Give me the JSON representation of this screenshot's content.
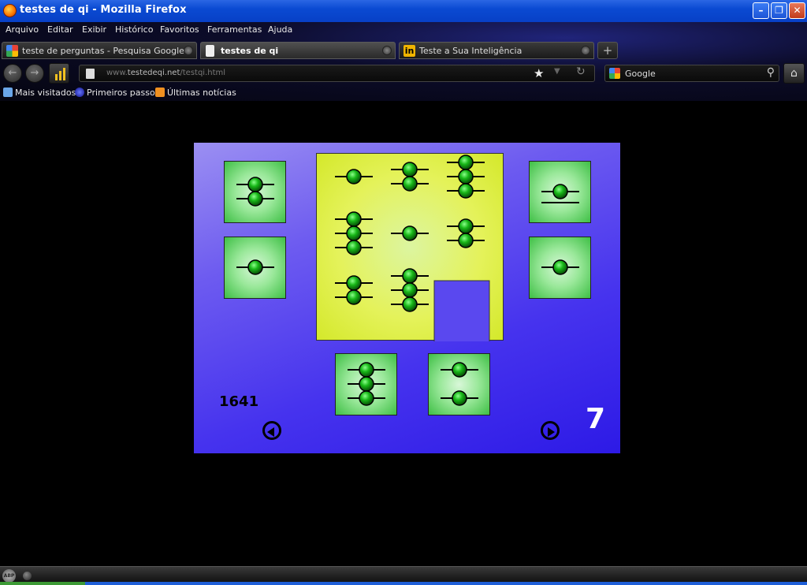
{
  "window": {
    "title": "testes de qi - Mozilla Firefox"
  },
  "menu": [
    "Arquivo",
    "Editar",
    "Exibir",
    "Histórico",
    "Favoritos",
    "Ferramentas",
    "Ajuda"
  ],
  "tabs": [
    {
      "label": "teste de perguntas - Pesquisa Google",
      "icon": "google-icon",
      "active": false
    },
    {
      "label": "testes de qi",
      "icon": "page-icon",
      "active": true
    },
    {
      "label": "Teste a Sua Inteligência",
      "icon": "in-icon",
      "active": false
    }
  ],
  "address": {
    "url_prefix": "www.",
    "url_domain": "testedeqi.net",
    "url_path": "/testqi.html"
  },
  "search": {
    "engine": "Google"
  },
  "bookmarks": [
    "Mais visitados",
    "Primeiros passos",
    "Últimas notícias"
  ],
  "game": {
    "score": "1641",
    "page": "7",
    "colors": {
      "card": "#7fd97f",
      "matrix": "#e2f04a",
      "ball": "#18b818",
      "background": "#4633ee"
    },
    "matrix": [
      [
        1,
        2,
        3
      ],
      [
        3,
        1,
        2
      ],
      [
        2,
        3,
        null
      ]
    ],
    "side_cards": [
      {
        "balls": 2,
        "position": "top-left",
        "underline": false
      },
      {
        "balls": 1,
        "position": "mid-left",
        "underline": false
      },
      {
        "balls": 1,
        "position": "top-right",
        "underline": true
      },
      {
        "balls": 1,
        "position": "mid-right",
        "underline": false
      }
    ],
    "bottom_cards": [
      {
        "balls": 3,
        "spread": false
      },
      {
        "balls": 2,
        "spread": true
      }
    ]
  }
}
